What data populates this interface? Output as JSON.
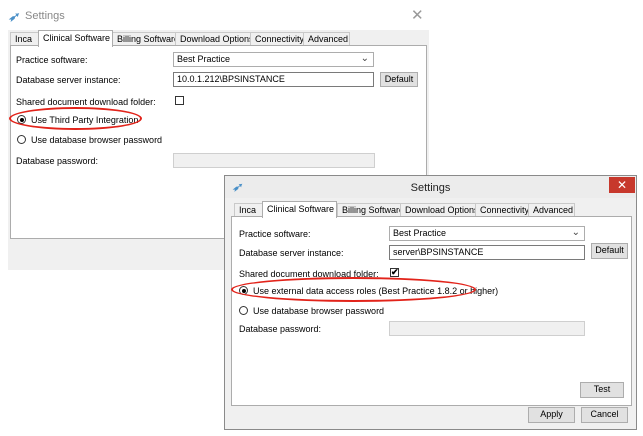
{
  "back_window": {
    "title": "Settings",
    "close_glyph": "✕",
    "tabs": [
      "Inca",
      "Clinical Software",
      "Billing Software",
      "Download Options",
      "Connectivity",
      "Advanced"
    ],
    "active_tab": "Clinical Software",
    "practice_software_label": "Practice software:",
    "practice_software_value": "Best Practice",
    "db_instance_label": "Database server instance:",
    "db_instance_value": "10.0.1.212\\BPSINSTANCE",
    "default_button": "Default",
    "shared_folder_label": "Shared document download folder:",
    "shared_folder_checked": false,
    "radio_third_party": "Use Third Party Integration",
    "radio_third_party_selected": true,
    "radio_browser_password": "Use database browser password",
    "db_password_label": "Database password:"
  },
  "front_window": {
    "title": "Settings",
    "close_glyph": "✕",
    "tabs": [
      "Inca",
      "Clinical Software",
      "Billing Software",
      "Download Options",
      "Connectivity",
      "Advanced"
    ],
    "active_tab": "Clinical Software",
    "practice_software_label": "Practice software:",
    "practice_software_value": "Best Practice",
    "db_instance_label": "Database server instance:",
    "db_instance_value": "server\\BPSINSTANCE",
    "default_button": "Default",
    "shared_folder_label": "Shared document download folder:",
    "shared_folder_checked": true,
    "check_glyph": "✔",
    "radio_external_roles": "Use external data access roles (Best Practice 1.8.2 or higher)",
    "radio_external_roles_selected": true,
    "radio_browser_password": "Use database browser password",
    "db_password_label": "Database password:",
    "test_button": "Test",
    "apply_button": "Apply",
    "cancel_button": "Cancel"
  },
  "icons": {
    "app": "quill-icon",
    "chevron": "chevron-down-icon",
    "close": "close-icon"
  },
  "colors": {
    "highlight": "#e2231a",
    "close_button_bg": "#c7382c",
    "panel_bg": "#f0f0f0"
  }
}
